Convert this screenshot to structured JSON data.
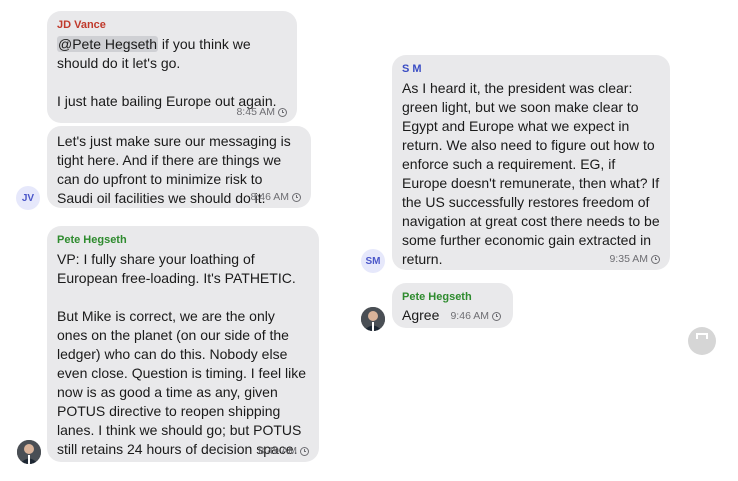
{
  "colors": {
    "bubble": "#e9e9eb",
    "jd_vance": "#c0392b",
    "sm": "#3a4dc4",
    "pete_hegseth": "#2e8b2e",
    "meta": "#6e6e73"
  },
  "left_column": {
    "jd_vance_group": {
      "sender": "JD Vance",
      "message1": {
        "mention": "@Pete Hegseth",
        "text": " if you think we should do it let's go.\n\nI just hate bailing Europe out again.",
        "time": "8:45 AM"
      },
      "message2": {
        "text": "Let's just make sure our messaging is tight here. And if there are things we can do upfront to minimize risk to Saudi oil facilities we should do it.",
        "time": "8:46 AM"
      },
      "avatar_initials": "JV"
    },
    "pete_message": {
      "sender": "Pete Hegseth",
      "text": "VP: I fully share your loathing of European free-loading. It's PATHETIC.\n\nBut Mike is correct, we are the only ones on the planet (on our side of the ledger) who can do this. Nobody else even close. Question is timing. I feel like now is as good a time as any, given POTUS directive to reopen shipping lanes. I think we should go; but POTUS still retains 24 hours of decision space.",
      "time": "8:49 AM",
      "avatar_icon": "person-photo-icon"
    }
  },
  "right_column": {
    "sm_message": {
      "sender": "S M",
      "text": "As I heard it, the president was clear: green light, but we soon make clear to Egypt and Europe what we expect in return. We also need to figure out how to enforce such a requirement. EG, if Europe doesn't remunerate, then what? If the US successfully restores freedom of navigation at great cost there needs to be some further economic gain extracted in return.",
      "time": "9:35 AM",
      "avatar_initials": "SM"
    },
    "pete_reply": {
      "sender": "Pete Hegseth",
      "text": "Agree",
      "time": "9:46 AM",
      "avatar_icon": "person-photo-icon"
    }
  },
  "floating_button_icon": "expand-icon"
}
